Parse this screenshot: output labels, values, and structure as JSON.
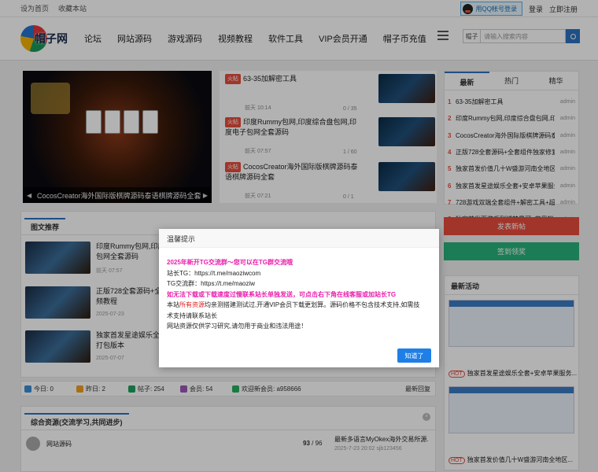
{
  "topbar": {
    "set_home": "设为首页",
    "bookmark": "收藏本站",
    "qq_login": "用QQ帐号登录",
    "login": "登录",
    "register": "立即注册"
  },
  "nav": {
    "logo_text": "帽子网",
    "items": [
      "论坛",
      "网站源码",
      "游戏源码",
      "视频教程",
      "软件工具",
      "VIP会员开通",
      "帽子币充值"
    ],
    "search_scope": "帽子",
    "search_placeholder": "请输入搜索内容"
  },
  "slider": {
    "caption": "CocosCreator海外国际版棋牌源码泰语棋牌源码全套",
    "prev": "◀",
    "next": "▶"
  },
  "hot_list": [
    {
      "badge": "火帖",
      "title": "63-35加解密工具",
      "date": "前天 10:14",
      "count": "0 / 35"
    },
    {
      "badge": "火帖",
      "title": "印度Rummy包网,印度综合盘包网,印度电子包网全套源码",
      "date": "前天 07:57",
      "count": "1 / 60"
    },
    {
      "badge": "火帖",
      "title": "CocosCreator海外国际版棋牌源码泰语棋牌源码全套",
      "date": "前天 07:21",
      "count": "0 / 1"
    }
  ],
  "tabs": {
    "items": [
      "最新",
      "热门",
      "精华"
    ],
    "list": [
      {
        "n": "1",
        "t": "63-35加解密工具",
        "a": "admin"
      },
      {
        "n": "2",
        "t": "印度Rummy包网,印度综合盘包网,印度",
        "a": "admin"
      },
      {
        "n": "3",
        "t": "CocosCreator海外国际版棋牌源码泰",
        "a": "admin"
      },
      {
        "n": "4",
        "t": "正版728全套源码+全套组件独家修复",
        "a": "admin"
      },
      {
        "n": "5",
        "t": "独家首发价值几十W盛游河南全地区",
        "a": "admin"
      },
      {
        "n": "6",
        "t": "独家首发星途娱乐全套+安卓苹果服务",
        "a": "admin"
      },
      {
        "n": "7",
        "t": "728游戏双端全套组件+解密工具+超",
        "a": "admin"
      },
      {
        "n": "8",
        "t": "独家首发百游系列博梦星河+苹果端",
        "a": "admin"
      }
    ]
  },
  "pic_section": {
    "title": "图文推荐",
    "items": [
      {
        "title1": "印度Rummy包网,印度综",
        "title2": "包网全套源码",
        "date": "前天 07:57"
      },
      {
        "title1": "正版728全套源码+全套",
        "title2": "频教程",
        "date": "2025-07-23"
      },
      {
        "title1": "独家首发星途娱乐全套+",
        "title2": "打包版本",
        "date": "2025-07-07"
      }
    ]
  },
  "actions": {
    "post": "发表新帖",
    "sign": "签到领奖"
  },
  "activity": {
    "title": "最新活动",
    "hot_label": "HOT",
    "items": [
      "独家首发星途娱乐全套+安卓苹果服务...",
      "独家首发价值几十W盛游河南全地区..."
    ]
  },
  "stats": {
    "today": "今日: 0",
    "yesterday": "昨日: 2",
    "posts": "帖子: 254",
    "members": "会员: 54",
    "welcome": "欢迎新会员: a958666",
    "latest": "最新回复"
  },
  "resources": {
    "title": "综合资源(交流学习,共同进步)",
    "close": "×",
    "rows": [
      {
        "name": "网站源码",
        "count_main": "93",
        "count_sub": " / 96",
        "latest1": "最新多语言MyOkex海外交易所源...",
        "latest2": "2025-7-23 20:02 sjb123456"
      }
    ]
  },
  "modal": {
    "title": "温馨提示",
    "line1": "2025年新开TG交流群～您可以在TG群交流哦",
    "line2": "站长TG：https://t.me/maoziwcom",
    "line3": "TG交流群：https://t.me/maoziw",
    "line4": "如无法下载或下载速度过慢联系站长单独发送，可点击右下角在线客服或加站长TG",
    "line5_a": "本站",
    "line5_b": "所有资源",
    "line5_c": "均亲测搭建测试过,开通VIP会员下载更划算。源码价格不包含技术支持,如需技",
    "line6": "术支持请联系站长",
    "line7": "网站资源仅供学习研究,请勿用于商业和违法用途！",
    "ok": "知道了"
  }
}
